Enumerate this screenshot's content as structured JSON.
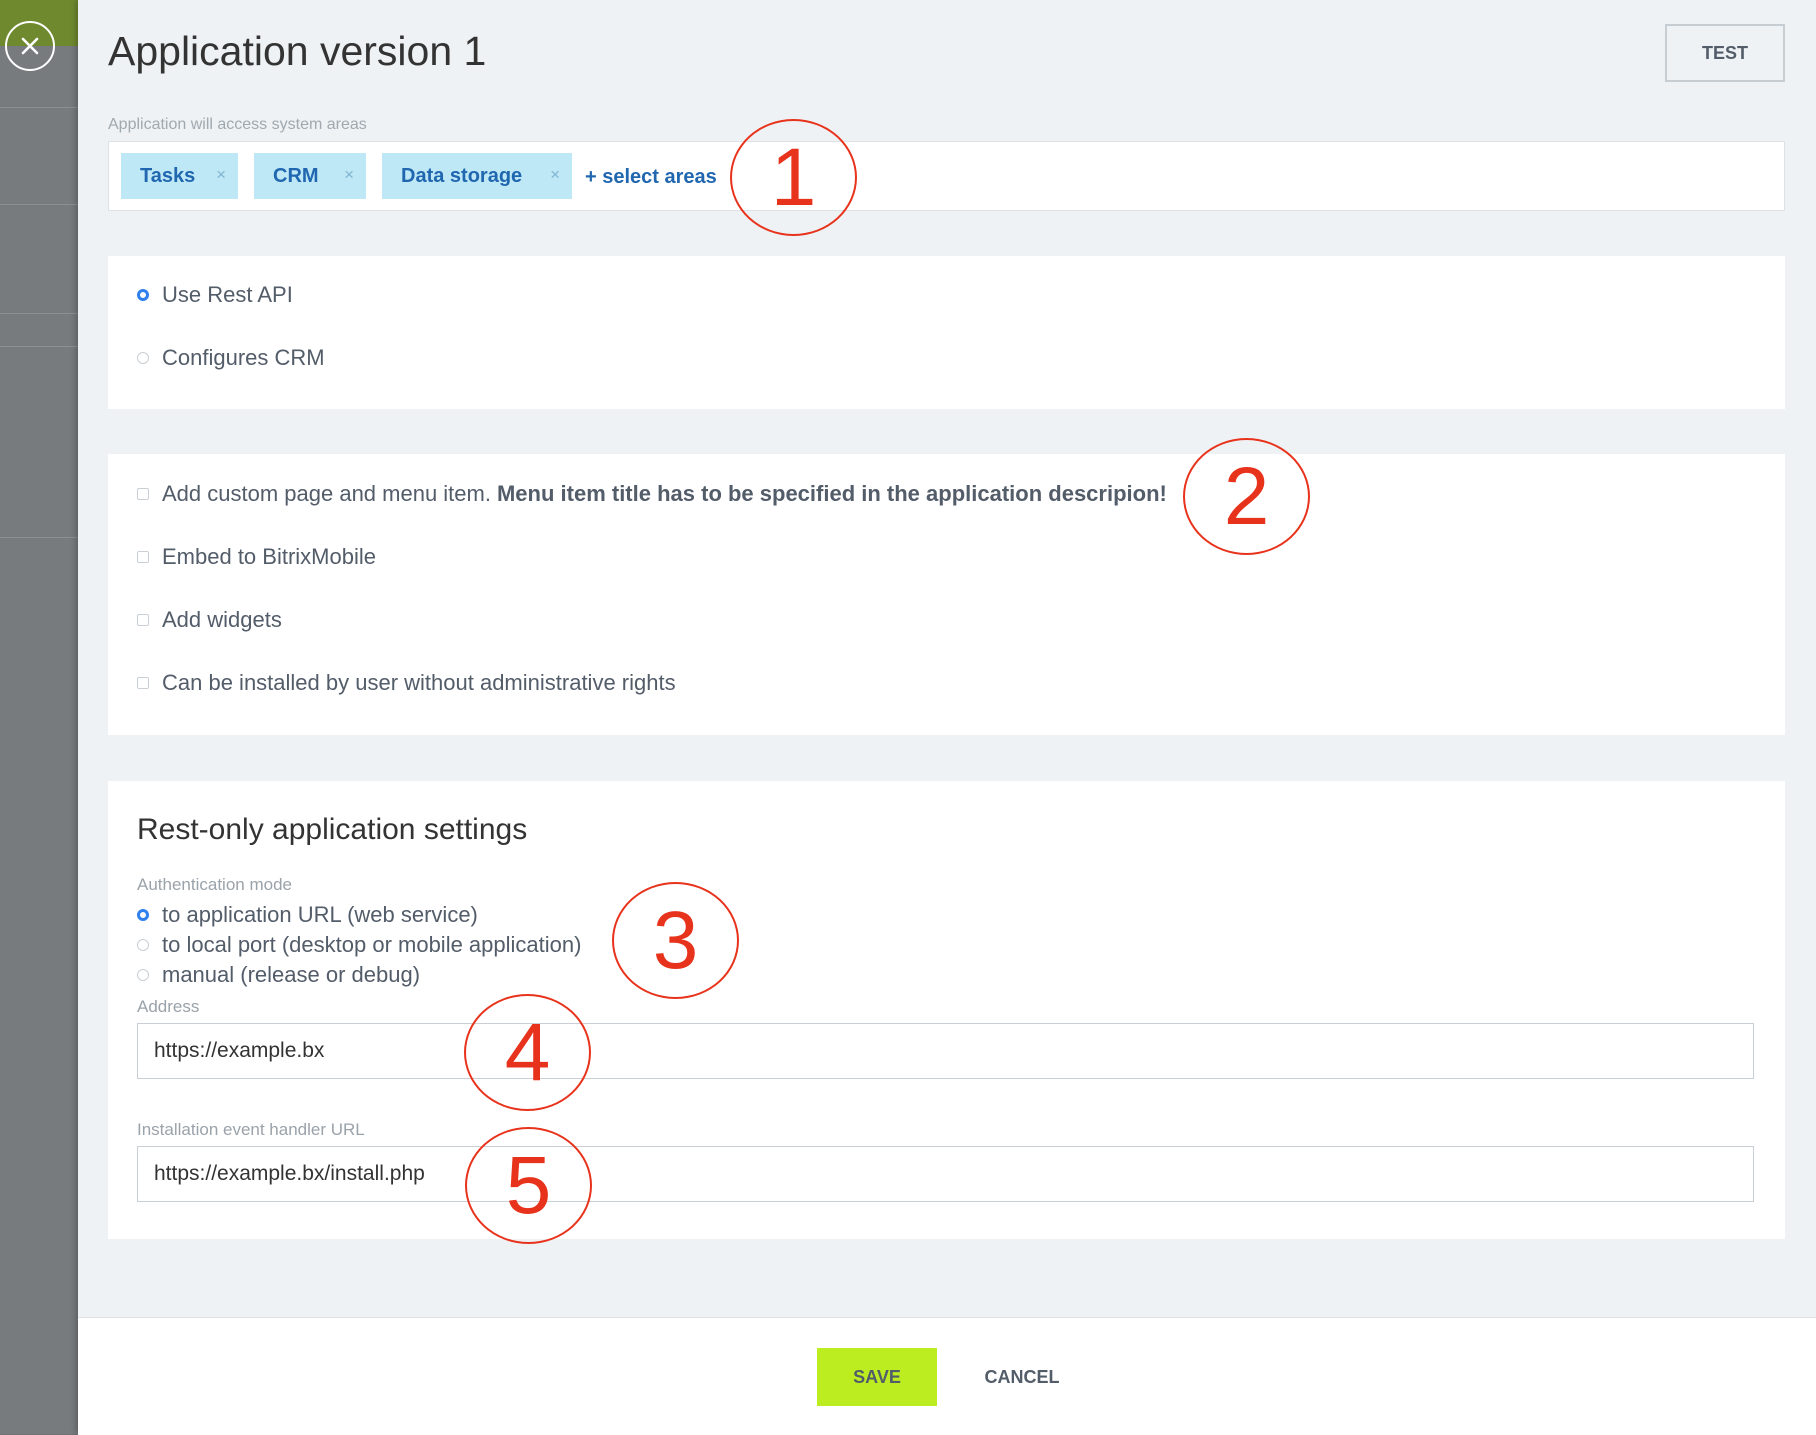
{
  "panel": {
    "title": "Application version 1",
    "test_label": "TEST"
  },
  "areas": {
    "label": "Application will access system areas",
    "tags": [
      {
        "label": "Tasks",
        "remove": "×"
      },
      {
        "label": "CRM",
        "remove": "×"
      },
      {
        "label": "Data storage",
        "remove": "×"
      }
    ],
    "select_label": "+ select areas"
  },
  "mode": {
    "options": [
      {
        "label": "Use Rest API",
        "checked": true
      },
      {
        "label": "Configures CRM",
        "checked": false
      }
    ]
  },
  "features": {
    "custom_page_label": "Add custom page and menu item.",
    "custom_page_note": "Menu item title has to be specified in the application descripion!",
    "embed_label": "Embed to BitrixMobile",
    "widgets_label": "Add widgets",
    "user_install_label": "Can be installed by user without administrative rights"
  },
  "rest_settings": {
    "heading": "Rest-only application settings",
    "auth_label": "Authentication mode",
    "auth_options": [
      {
        "label": "to application URL (web service)",
        "checked": true
      },
      {
        "label": "to local port (desktop or mobile application)",
        "checked": false
      },
      {
        "label": "manual (release or debug)",
        "checked": false
      }
    ],
    "address_label": "Address",
    "address_value": "https://example.bx",
    "handler_label": "Installation event handler URL",
    "handler_value": "https://example.bx/install.php"
  },
  "footer": {
    "save_label": "SAVE",
    "cancel_label": "CANCEL"
  },
  "annotations": [
    "1",
    "2",
    "3",
    "4",
    "5"
  ],
  "colors": {
    "accent_blue": "#2067b0",
    "tag_background": "#bfe8f7",
    "save_green": "#bbed21",
    "annotation_red": "#e8331c"
  },
  "icons": {
    "close": "close-icon",
    "radio": "radio-icon",
    "checkbox": "checkbox-icon"
  }
}
